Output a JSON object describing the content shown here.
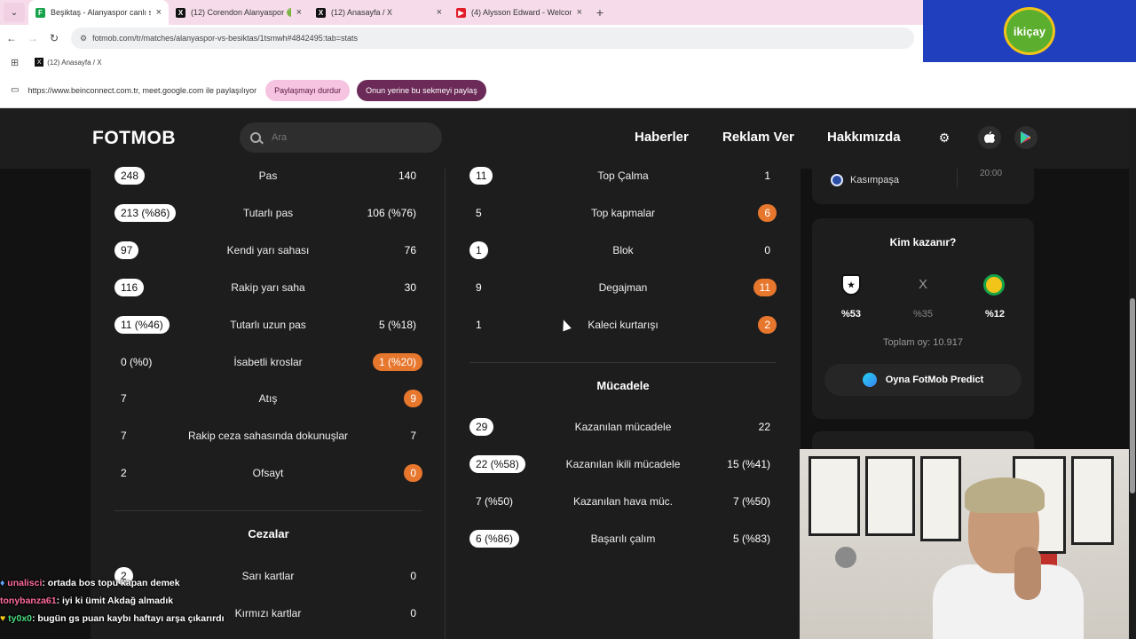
{
  "browser": {
    "tabs": [
      {
        "title": "Beşiktaş - Alanyaspor canlı skor",
        "active": true,
        "favicon": "F",
        "favicon_color": "#16a34a"
      },
      {
        "title": "(12) Corendon Alanyaspor 🟢🟠",
        "active": false,
        "favicon": "X",
        "favicon_color": "#111111"
      },
      {
        "title": "(12) Anasayfa / X",
        "active": false,
        "favicon": "X",
        "favicon_color": "#111111"
      },
      {
        "title": "(4) Alysson Edward - Welcome",
        "active": false,
        "favicon": "▶",
        "favicon_color": "#e11d2a"
      }
    ],
    "new_tab": "+",
    "url": "fotmob.com/tr/matches/alanyaspor-vs-besiktas/1tsmwh#4842495:tab=stats",
    "bookmark": "(12) Anasayfa / X",
    "share_text": "https://www.beinconnect.com.tr, meet.google.com ile paylaşılıyor",
    "stop_sharing": "Paylaşmayı durdur",
    "share_this_tab": "Onun yerine bu sekmeyi paylaş"
  },
  "sponsor": {
    "logo_text": "ikiçay"
  },
  "header": {
    "logo": "FOTMOB",
    "search_placeholder": "Ara",
    "nav": [
      "Haberler",
      "Reklam Ver",
      "Hakkımızda"
    ],
    "icons": [
      "gear-icon",
      "apple-icon",
      "play-store-icon"
    ]
  },
  "stats_left": [
    {
      "home": "248",
      "label": "Pas",
      "away": "140",
      "home_style": "pill-w",
      "away_style": "plain"
    },
    {
      "home": "213 (%86)",
      "label": "Tutarlı pas",
      "away": "106 (%76)",
      "home_style": "pill-w",
      "away_style": "plain"
    },
    {
      "home": "97",
      "label": "Kendi yarı sahası",
      "away": "76",
      "home_style": "pill-w",
      "away_style": "plain"
    },
    {
      "home": "116",
      "label": "Rakip yarı saha",
      "away": "30",
      "home_style": "pill-w",
      "away_style": "plain"
    },
    {
      "home": "11 (%46)",
      "label": "Tutarlı uzun pas",
      "away": "5 (%18)",
      "home_style": "pill-w",
      "away_style": "plain"
    },
    {
      "home": "0 (%0)",
      "label": "İsabetli kroslar",
      "away": "1 (%20)",
      "home_style": "plain",
      "away_style": "pill-o"
    },
    {
      "home": "7",
      "label": "Atış",
      "away": "9",
      "home_style": "plain",
      "away_style": "pill-o"
    },
    {
      "home": "7",
      "label": "Rakip ceza sahasında dokunuşlar",
      "away": "7",
      "home_style": "plain",
      "away_style": "plain"
    },
    {
      "home": "2",
      "label": "Ofsayt",
      "away": "0",
      "home_style": "plain",
      "away_style": "pill-o"
    }
  ],
  "cezalar": {
    "title": "Cezalar",
    "rows": [
      {
        "home": "2",
        "label": "Sarı kartlar",
        "away": "0",
        "home_style": "pill-w",
        "away_style": "plain"
      },
      {
        "home": "",
        "label": "Kırmızı kartlar",
        "away": "0",
        "home_style": "plain",
        "away_style": "plain"
      }
    ]
  },
  "stats_right": [
    {
      "home": "11",
      "label": "Top Çalma",
      "away": "1",
      "home_style": "pill-w",
      "away_style": "plain"
    },
    {
      "home": "5",
      "label": "Top kapmalar",
      "away": "6",
      "home_style": "plain",
      "away_style": "pill-o"
    },
    {
      "home": "1",
      "label": "Blok",
      "away": "0",
      "home_style": "pill-w",
      "away_style": "plain"
    },
    {
      "home": "9",
      "label": "Degajman",
      "away": "11",
      "home_style": "plain",
      "away_style": "pill-o"
    },
    {
      "home": "1",
      "label": "Kaleci kurtarışı",
      "away": "2",
      "home_style": "plain",
      "away_style": "pill-o"
    }
  ],
  "mucadele": {
    "title": "Mücadele",
    "rows": [
      {
        "home": "29",
        "label": "Kazanılan mücadele",
        "away": "22",
        "home_style": "pill-w",
        "away_style": "plain"
      },
      {
        "home": "22 (%58)",
        "label": "Kazanılan ikili mücadele",
        "away": "15 (%41)",
        "home_style": "pill-w",
        "away_style": "plain"
      },
      {
        "home": "7 (%50)",
        "label": "Kazanılan hava müc.",
        "away": "7 (%50)",
        "home_style": "plain",
        "away_style": "plain"
      },
      {
        "home": "6 (%86)",
        "label": "Başarılı çalım",
        "away": "5 (%83)",
        "home_style": "pill-w",
        "away_style": "plain"
      }
    ]
  },
  "sidebar": {
    "next_match": {
      "team": "Kasımpaşa",
      "time": "20:00"
    },
    "poll": {
      "title": "Kim kazanır?",
      "draw_label": "X",
      "home_pct": "%53",
      "draw_pct": "%35",
      "away_pct": "%12",
      "total_votes": "Toplam oy: 10.917",
      "predict_button": "Oyna FotMob Predict"
    }
  },
  "chat": [
    {
      "user": "",
      "user_color": "#888888",
      "text": "",
      "faded": true
    },
    {
      "user": "unalisci",
      "user_color": "#ff6b9a",
      "text": ": ortada bos topu kapan demek",
      "faded": false
    },
    {
      "user": "tonybanza61",
      "user_color": "#ff6b9a",
      "text": ": iyi ki ümit Akdağ almadık",
      "faded": false
    },
    {
      "user": "ty0x0",
      "user_color": "#4ade80",
      "text": ": bugün gs puan kaybı haftayı arşa çıkarırdı",
      "faded": false
    }
  ]
}
